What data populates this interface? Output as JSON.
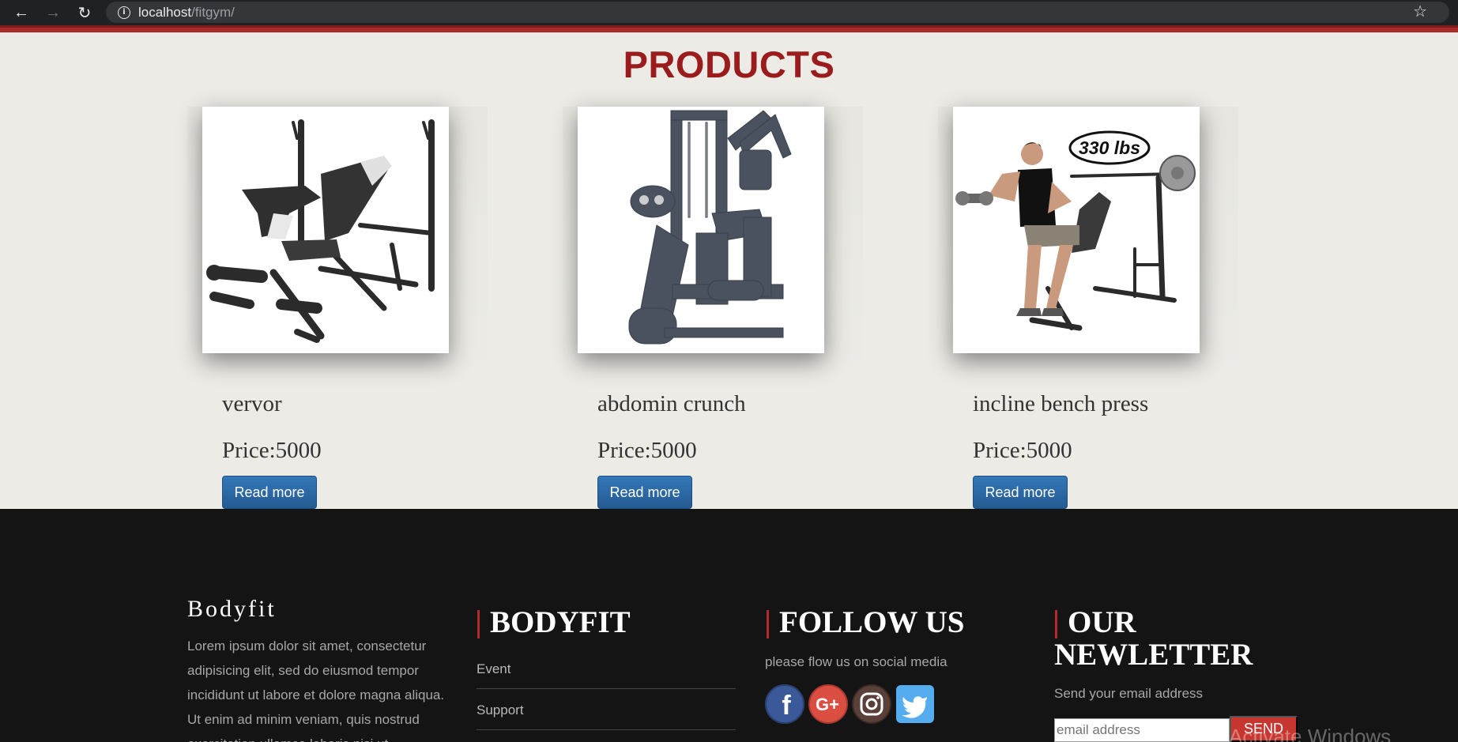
{
  "browser": {
    "url_host": "localhost",
    "url_path": "/fitgym/"
  },
  "products": {
    "title": "PRODUCTS",
    "items": [
      {
        "name": "vervor",
        "price": "Price:5000",
        "button": "Read more"
      },
      {
        "name": "abdomin crunch",
        "price": "Price:5000",
        "button": "Read more"
      },
      {
        "name": "incline bench press",
        "price": "Price:5000",
        "button": "Read more",
        "badge": "330 lbs"
      }
    ]
  },
  "footer": {
    "brand": "Bodyfit",
    "lorem": "Lorem ipsum dolor sit amet, consectetur adipisicing elit, sed do eiusmod tempor incididunt ut labore et dolore magna aliqua. Ut enim ad minim veniam, quis nostrud exercitation ullamco laboris nisi ut",
    "col2_title": "BODYFIT",
    "links": [
      "Event",
      "Support"
    ],
    "col3_title": "FOLLOW US",
    "follow_text": "please flow us on social media",
    "socials": [
      "facebook",
      "google-plus",
      "instagram",
      "twitter"
    ],
    "col4_title_line1": "OUR",
    "col4_title_line2": "NEWLETTER",
    "newsletter_text": "Send your email address",
    "email_placeholder": "email address",
    "send_label": "SEND",
    "watermark": "Activate Windows"
  },
  "colors": {
    "accent_red": "#9b1c1c",
    "button_blue": "#2d6ca6",
    "footer_bg": "#141414",
    "page_bg": "#ecebe6"
  }
}
